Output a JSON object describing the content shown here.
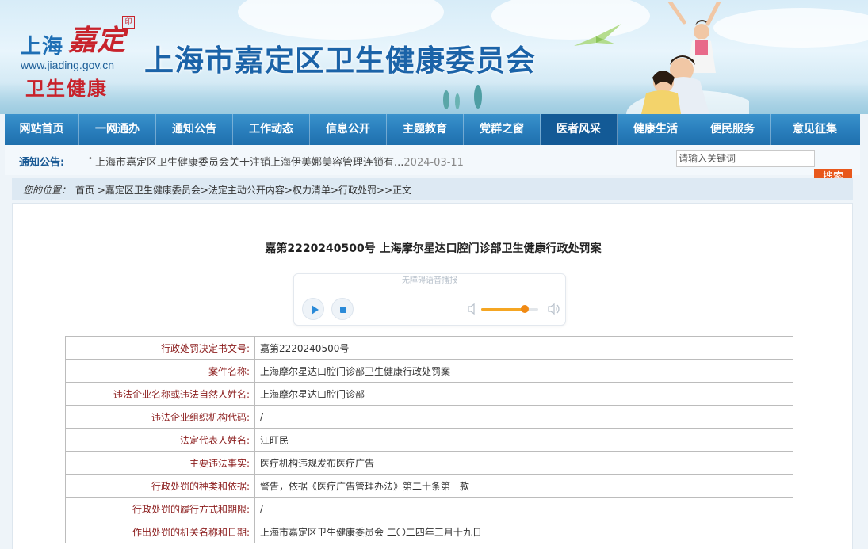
{
  "header": {
    "logo_top": "上海",
    "logo_script": "嘉定",
    "logo_seal": "印",
    "logo_url": "www.jiading.gov.cn",
    "logo_health": "卫生健康",
    "site_title": "上海市嘉定区卫生健康委员会"
  },
  "nav": {
    "items": [
      {
        "label": "网站首页"
      },
      {
        "label": "一网通办"
      },
      {
        "label": "通知公告"
      },
      {
        "label": "工作动态"
      },
      {
        "label": "信息公开"
      },
      {
        "label": "主题教育"
      },
      {
        "label": "党群之窗"
      },
      {
        "label": "医者风采"
      },
      {
        "label": "健康生活"
      },
      {
        "label": "便民服务"
      },
      {
        "label": "意见征集"
      }
    ],
    "active_index": 7
  },
  "notice": {
    "label": "通知公告:",
    "bullet": "•",
    "text": "上海市嘉定区卫生健康委员会关于注销上海伊美娜美容管理连锁有...",
    "date": "2024-03-11"
  },
  "search": {
    "placeholder": "请输入关键词",
    "button_label": "搜索"
  },
  "breadcrumb": {
    "label": "您的位置：",
    "path": "首页 >嘉定区卫生健康委员会>法定主动公开内容>权力清单>行政处罚>>正文"
  },
  "document": {
    "title": "嘉第2220240500号 上海摩尔星达口腔门诊部卫生健康行政处罚案"
  },
  "player": {
    "header": "无障碍语音播报",
    "volume_fraction": 0.77
  },
  "table": {
    "rows": [
      {
        "key": "行政处罚决定书文号:",
        "value": "嘉第2220240500号"
      },
      {
        "key": "案件名称:",
        "value": "上海摩尔星达口腔门诊部卫生健康行政处罚案"
      },
      {
        "key": "违法企业名称或违法自然人姓名:",
        "value": "上海摩尔星达口腔门诊部"
      },
      {
        "key": "违法企业组织机构代码:",
        "value": "/"
      },
      {
        "key": "法定代表人姓名:",
        "value": "江旺民"
      },
      {
        "key": "主要违法事实:",
        "value": "医疗机构违规发布医疗广告"
      },
      {
        "key": "行政处罚的种类和依据:",
        "value": "警告，依据《医疗广告管理办法》第二十条第一款"
      },
      {
        "key": "行政处罚的履行方式和期限:",
        "value": "/"
      },
      {
        "key": "作出处罚的机关名称和日期:",
        "value": "上海市嘉定区卫生健康委员会 二〇二四年三月十九日"
      }
    ]
  },
  "colors": {
    "nav_bg": "#2a7fbd",
    "nav_active": "#135a96",
    "search_button": "#e8581c",
    "table_key": "#8b1c1c"
  }
}
